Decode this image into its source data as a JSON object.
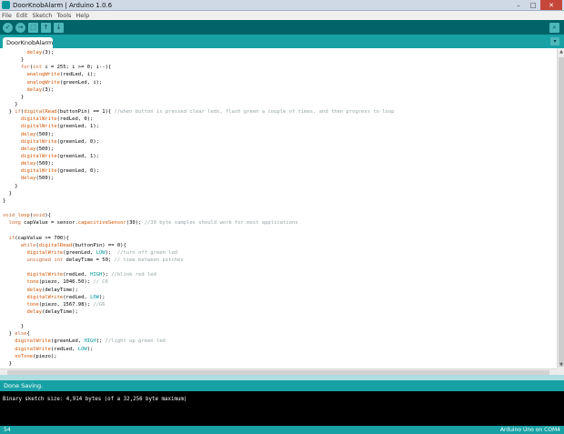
{
  "window": {
    "title": "DoorKnobAlarm | Arduino 1.0.6",
    "controls": [
      "–",
      "□",
      "✕"
    ]
  },
  "menu": [
    "File",
    "Edit",
    "Sketch",
    "Tools",
    "Help"
  ],
  "toolbar": {
    "verify": "✓",
    "upload": "→",
    "new": "⬚",
    "open": "↑",
    "save": "↓",
    "serial_monitor": "⌕"
  },
  "tabs": [
    {
      "label": "DoorKnobAlarm"
    }
  ],
  "tab_menu_icon": "▾",
  "code_lines": [
    [
      {
        "t": "        "
      },
      {
        "t": "delay",
        "c": "fn"
      },
      {
        "t": "(3);"
      }
    ],
    [
      {
        "t": "      }"
      }
    ],
    [
      {
        "t": "      "
      },
      {
        "t": "for",
        "c": "kw"
      },
      {
        "t": "("
      },
      {
        "t": "int",
        "c": "ty"
      },
      {
        "t": " i = 255; i >= 0; i--){"
      }
    ],
    [
      {
        "t": "        "
      },
      {
        "t": "analogWrite",
        "c": "fn"
      },
      {
        "t": "(redLed, i);"
      }
    ],
    [
      {
        "t": "        "
      },
      {
        "t": "analogWrite",
        "c": "fn"
      },
      {
        "t": "(greenLed, i);"
      }
    ],
    [
      {
        "t": "        "
      },
      {
        "t": "delay",
        "c": "fn"
      },
      {
        "t": "(3);"
      }
    ],
    [
      {
        "t": "      }"
      }
    ],
    [
      {
        "t": "    }"
      }
    ],
    [
      {
        "t": "  } "
      },
      {
        "t": "if",
        "c": "kw"
      },
      {
        "t": "("
      },
      {
        "t": "digitalRead",
        "c": "fn"
      },
      {
        "t": "(buttonPin) == 1){ "
      },
      {
        "t": "//when button is pressed clear leds, flash green a couple of times, and then progress to loop",
        "c": "cm"
      }
    ],
    [
      {
        "t": "      "
      },
      {
        "t": "digitalWrite",
        "c": "fn"
      },
      {
        "t": "(redLed, 0);"
      }
    ],
    [
      {
        "t": "      "
      },
      {
        "t": "digitalWrite",
        "c": "fn"
      },
      {
        "t": "(greenLed, 1);"
      }
    ],
    [
      {
        "t": "      "
      },
      {
        "t": "delay",
        "c": "fn"
      },
      {
        "t": "(500);"
      }
    ],
    [
      {
        "t": "      "
      },
      {
        "t": "digitalWrite",
        "c": "fn"
      },
      {
        "t": "(greenLed, 0);"
      }
    ],
    [
      {
        "t": "      "
      },
      {
        "t": "delay",
        "c": "fn"
      },
      {
        "t": "(500);"
      }
    ],
    [
      {
        "t": "      "
      },
      {
        "t": "digitalWrite",
        "c": "fn"
      },
      {
        "t": "(greenLed, 1);"
      }
    ],
    [
      {
        "t": "      "
      },
      {
        "t": "delay",
        "c": "fn"
      },
      {
        "t": "(500);"
      }
    ],
    [
      {
        "t": "      "
      },
      {
        "t": "digitalWrite",
        "c": "fn"
      },
      {
        "t": "(greenLed, 0);"
      }
    ],
    [
      {
        "t": "      "
      },
      {
        "t": "delay",
        "c": "fn"
      },
      {
        "t": "(500);"
      }
    ],
    [
      {
        "t": "    }"
      }
    ],
    [
      {
        "t": "  }"
      }
    ],
    [
      {
        "t": "}"
      }
    ],
    [
      {
        "t": ""
      }
    ],
    [
      {
        "t": "void",
        "c": "ty"
      },
      {
        "t": " "
      },
      {
        "t": "loop",
        "c": "fn"
      },
      {
        "t": "("
      },
      {
        "t": "void",
        "c": "ty"
      },
      {
        "t": "){"
      }
    ],
    [
      {
        "t": "  "
      },
      {
        "t": "long",
        "c": "ty"
      },
      {
        "t": " capValue = sensor."
      },
      {
        "t": "capacitiveSensor",
        "c": "fn"
      },
      {
        "t": "(30); "
      },
      {
        "t": "//30 byte samples should work for most applications",
        "c": "cm"
      }
    ],
    [
      {
        "t": ""
      }
    ],
    [
      {
        "t": "  "
      },
      {
        "t": "if",
        "c": "kw"
      },
      {
        "t": "(capValue >= 700){"
      }
    ],
    [
      {
        "t": "      "
      },
      {
        "t": "while",
        "c": "kw"
      },
      {
        "t": "("
      },
      {
        "t": "digitalRead",
        "c": "fn"
      },
      {
        "t": "(buttonPin) == 0){"
      }
    ],
    [
      {
        "t": "        "
      },
      {
        "t": "digitalWrite",
        "c": "fn"
      },
      {
        "t": "(greenLed, "
      },
      {
        "t": "LOW",
        "c": "cn"
      },
      {
        "t": ");  "
      },
      {
        "t": "//turn off green led",
        "c": "cm"
      }
    ],
    [
      {
        "t": "        "
      },
      {
        "t": "unsigned",
        "c": "ty"
      },
      {
        "t": " "
      },
      {
        "t": "int",
        "c": "ty"
      },
      {
        "t": " delayTime = 50; "
      },
      {
        "t": "// time between pitches",
        "c": "cm"
      }
    ],
    [
      {
        "t": ""
      }
    ],
    [
      {
        "t": "        "
      },
      {
        "t": "digitalWrite",
        "c": "fn"
      },
      {
        "t": "(redLed, "
      },
      {
        "t": "HIGH",
        "c": "cn"
      },
      {
        "t": "); "
      },
      {
        "t": "//blink red led",
        "c": "cm"
      }
    ],
    [
      {
        "t": "        "
      },
      {
        "t": "tone",
        "c": "fn"
      },
      {
        "t": "(piezo, 1046.50); "
      },
      {
        "t": "// C6",
        "c": "cm"
      }
    ],
    [
      {
        "t": "        "
      },
      {
        "t": "delay",
        "c": "fn"
      },
      {
        "t": "(delayTime);"
      }
    ],
    [
      {
        "t": "        "
      },
      {
        "t": "digitalWrite",
        "c": "fn"
      },
      {
        "t": "(redLed, "
      },
      {
        "t": "LOW",
        "c": "cn"
      },
      {
        "t": ");"
      }
    ],
    [
      {
        "t": "        "
      },
      {
        "t": "tone",
        "c": "fn"
      },
      {
        "t": "(piezo, 1567.98); "
      },
      {
        "t": "//G6",
        "c": "cm"
      }
    ],
    [
      {
        "t": "        "
      },
      {
        "t": "delay",
        "c": "fn"
      },
      {
        "t": "(delayTime);"
      }
    ],
    [
      {
        "t": ""
      }
    ],
    [
      {
        "t": "      }"
      }
    ],
    [
      {
        "t": "  } "
      },
      {
        "t": "else",
        "c": "kw"
      },
      {
        "t": "{"
      }
    ],
    [
      {
        "t": "    "
      },
      {
        "t": "digitalWrite",
        "c": "fn"
      },
      {
        "t": "(greenLed, "
      },
      {
        "t": "HIGH",
        "c": "cn"
      },
      {
        "t": "); "
      },
      {
        "t": "//light up green led",
        "c": "cm"
      }
    ],
    [
      {
        "t": "    "
      },
      {
        "t": "digitalWrite",
        "c": "fn"
      },
      {
        "t": "(redLed, "
      },
      {
        "t": "LOW",
        "c": "cn"
      },
      {
        "t": ");"
      }
    ],
    [
      {
        "t": "    "
      },
      {
        "t": "noTone",
        "c": "fn"
      },
      {
        "t": "(piezo);"
      }
    ],
    [
      {
        "t": "  }"
      }
    ],
    [
      {
        "t": "}"
      }
    ]
  ],
  "status": {
    "message": "Done Saving."
  },
  "console": {
    "message": "Binary sketch size: 4,914 bytes (of a 32,256 byte maximum)"
  },
  "footer": {
    "line_number": "54",
    "board": "Arduino Uno on COM4"
  },
  "colors": {
    "toolbar": "#006468",
    "tabs_and_status": "#17a1a5",
    "console": "#000000",
    "function": "#d35400",
    "keyword": "#cc6633",
    "comment": "#95a5a6",
    "constant": "#00979c"
  }
}
